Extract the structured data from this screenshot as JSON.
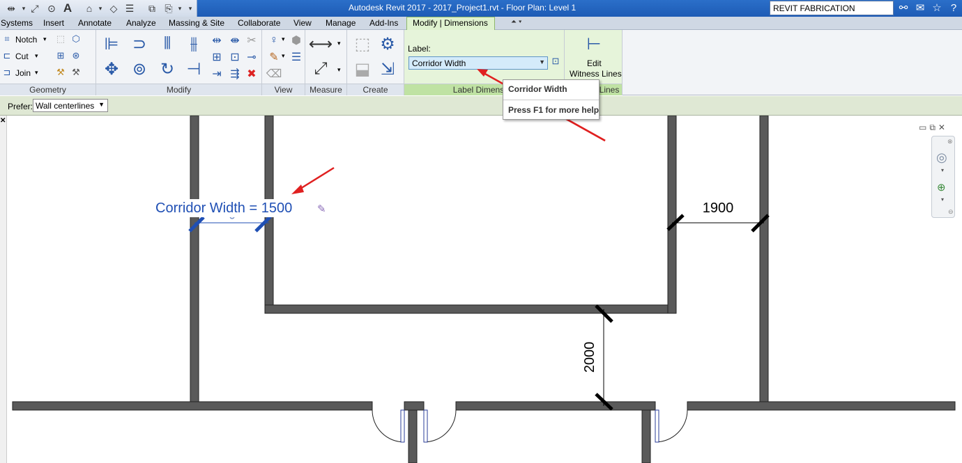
{
  "app": {
    "title": "Autodesk Revit 2017 -     2017_Project1.rvt - Floor Plan: Level 1",
    "search_value": "REVIT FABRICATION"
  },
  "tabs": [
    {
      "label": "Systems"
    },
    {
      "label": "Insert"
    },
    {
      "label": "Annotate"
    },
    {
      "label": "Analyze"
    },
    {
      "label": "Massing & Site"
    },
    {
      "label": "Collaborate"
    },
    {
      "label": "View"
    },
    {
      "label": "Manage"
    },
    {
      "label": "Add-Ins"
    },
    {
      "label": "Modify | Dimensions"
    }
  ],
  "ribbon": {
    "geometry": {
      "notch": "Notch",
      "cut": "Cut",
      "join": "Join",
      "label": "Geometry"
    },
    "modify": {
      "label": "Modify"
    },
    "view": {
      "label": "View"
    },
    "measure": {
      "label": "Measure"
    },
    "create": {
      "label": "Create"
    },
    "label_dimension": {
      "field_label": "Label:",
      "value": "Corridor Width",
      "panel_label": "Label Dimension"
    },
    "witness": {
      "button_line1": "Edit",
      "button_line2": "Witness Lines",
      "panel_label": "Witness Lines"
    }
  },
  "tooltip": {
    "title": "Corridor Width",
    "help": "Press F1 for more help"
  },
  "options_bar": {
    "prefer_label": "Prefer:",
    "prefer_value": "Wall centerlines"
  },
  "drawing": {
    "selected_dimension": "Corridor Width = 1500",
    "dim_horizontal": "1900",
    "dim_vertical": "2000"
  },
  "colors": {
    "annotation_arrow": "#e02020",
    "selected_dim": "#1f4fb4",
    "wall_fill": "#5a5a5a",
    "active_tab": "#dff2cf"
  }
}
